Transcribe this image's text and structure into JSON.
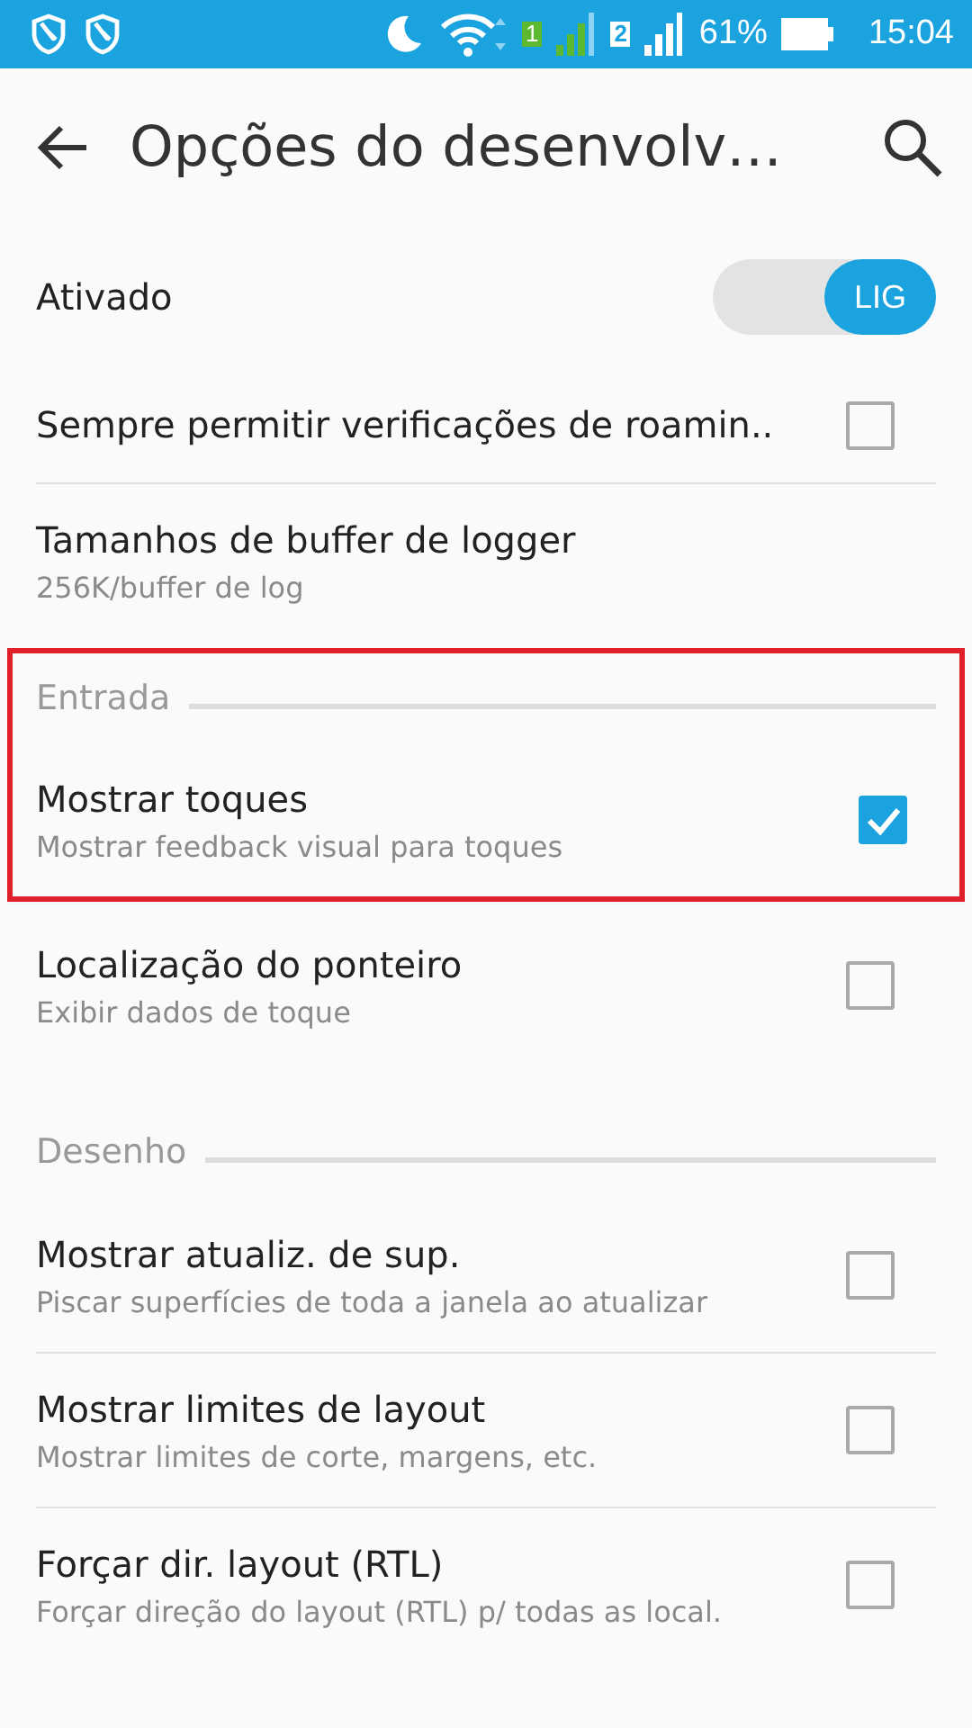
{
  "status_bar": {
    "sim_1": "1",
    "sim_2": "2",
    "battery": "61%",
    "time": "15:04"
  },
  "app_bar": {
    "title": "Opções do desenvolv…"
  },
  "master_switch": {
    "label": "Ativado",
    "on": true,
    "state_text": "LIG"
  },
  "sections": [
    {
      "items": [
        {
          "kind": "checkbox",
          "title": "Sempre permitir verificações de roamin..",
          "checked": false
        },
        {
          "kind": "plain",
          "title": "Tamanhos de buffer de logger",
          "summary": "256K/buffer de log"
        }
      ]
    },
    {
      "title": "Entrada",
      "highlighted": true,
      "items": [
        {
          "kind": "checkbox",
          "title": "Mostrar toques",
          "summary": "Mostrar feedback visual para toques",
          "checked": true
        }
      ]
    },
    {
      "items": [
        {
          "kind": "checkbox",
          "title": "Localização do ponteiro",
          "summary": "Exibir dados de toque",
          "checked": false
        }
      ]
    },
    {
      "title": "Desenho",
      "items": [
        {
          "kind": "checkbox",
          "title": "Mostrar atualiz. de sup.",
          "summary": "Piscar superfícies de toda a janela ao atualizar",
          "checked": false
        },
        {
          "kind": "checkbox",
          "title": "Mostrar limites de layout",
          "summary": "Mostrar limites de corte, margens, etc.",
          "checked": false
        },
        {
          "kind": "checkbox",
          "title": "Forçar dir. layout (RTL)",
          "summary": "Forçar direção do layout (RTL) p/ todas as local.",
          "checked": false
        }
      ]
    }
  ]
}
